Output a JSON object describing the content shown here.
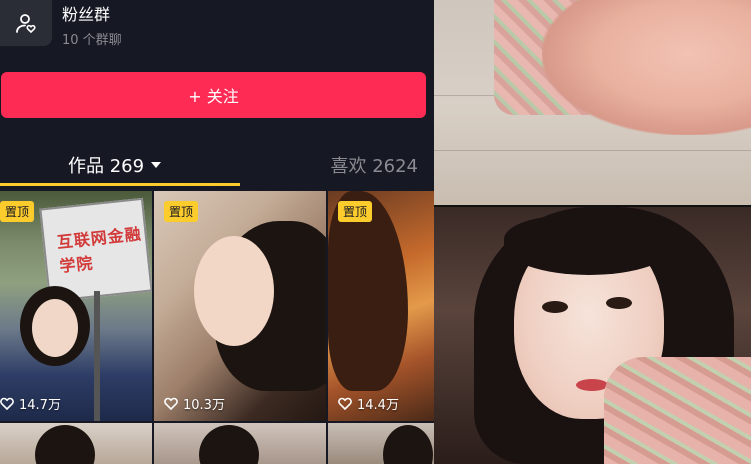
{
  "fan_group": {
    "title": "粉丝群",
    "subtitle": "10 个群聊",
    "icon": "user-heart-icon"
  },
  "follow_button": {
    "label": "+ 关注"
  },
  "tabs": {
    "works_label": "作品 269",
    "likes_label": "喜欢 2624"
  },
  "colors": {
    "accent": "#fe2c55",
    "background": "#161823",
    "tab_indicator": "#fccb2c",
    "pin_badge": "#fccb2c"
  },
  "videos": [
    {
      "pinned": "置顶",
      "likes": "14.7万"
    },
    {
      "pinned": "置顶",
      "likes": "10.3万"
    },
    {
      "pinned": "置顶",
      "likes": "14.4万"
    }
  ],
  "sign_text": "互联网金融学院"
}
